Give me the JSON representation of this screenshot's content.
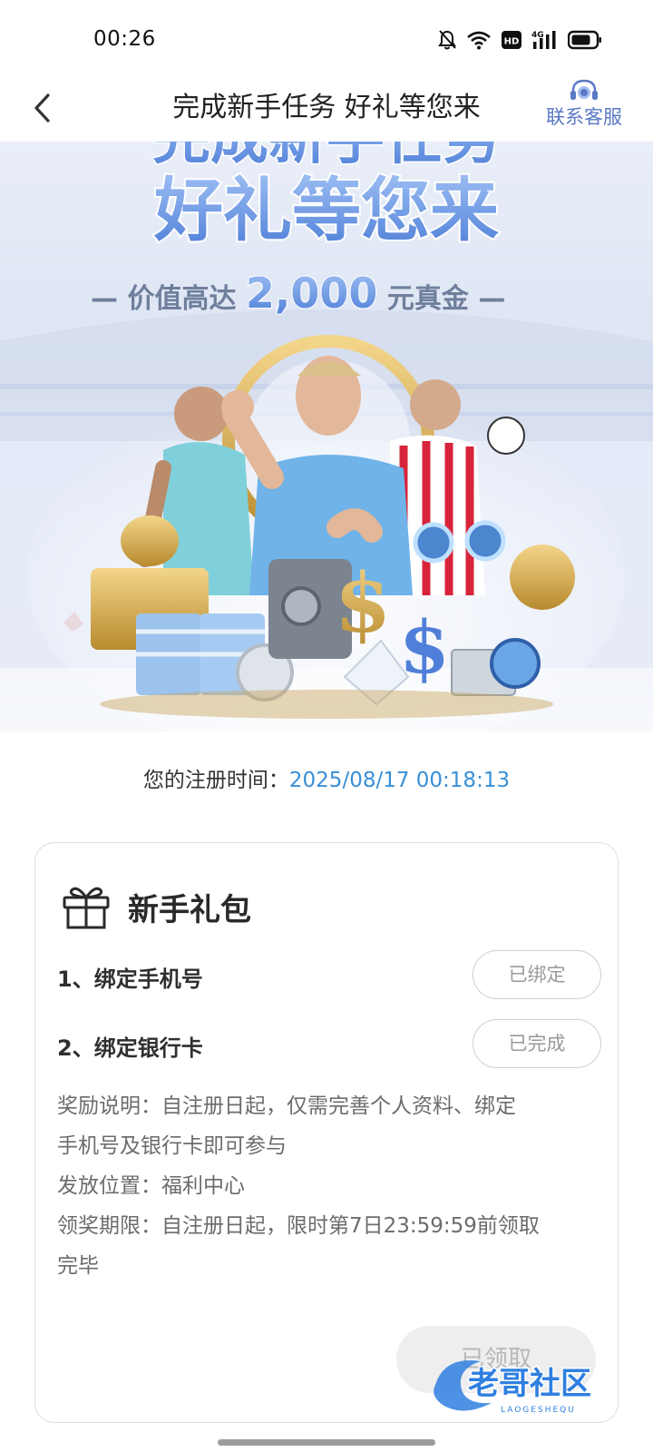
{
  "status_bar": {
    "time": "00:26",
    "icons": [
      "mute-icon",
      "wifi-icon",
      "hd-icon",
      "signal-4g-icon",
      "battery-icon"
    ],
    "hd_text": "HD",
    "net_text": "4G"
  },
  "nav": {
    "title": "完成新手任务 好礼等您来",
    "back_icon": "chevron-left-icon",
    "support_label": "联系客服",
    "support_icon": "headset-icon"
  },
  "banner": {
    "headline_top": "完成新手任务",
    "headline": "好礼等您来",
    "sub_prefix": "— 价值高达",
    "sub_amount": "2,000",
    "sub_suffix": "元真金 —"
  },
  "registration": {
    "label": "您的注册时间：",
    "value": "2025/08/17 00:18:13"
  },
  "gift_card": {
    "icon": "gift-icon",
    "title": "新手礼包",
    "tasks": [
      {
        "label": "1、绑定手机号",
        "status": "已绑定"
      },
      {
        "label": "2、绑定银行卡",
        "status": "已完成"
      }
    ],
    "reward_desc_1": "奖励说明：自注册日起，仅需完善个人资料、绑定",
    "reward_desc_2": "手机号及银行卡即可参与",
    "location": "发放位置：福利中心",
    "deadline_1": "领奖期限：自注册日起，限时第7日23:59:59前领取",
    "deadline_2": "完毕",
    "claim_label": "已领取"
  },
  "watermark": {
    "text": "老哥社区",
    "sub": "LAOGESHEQU"
  },
  "colors": {
    "accent_blue": "#3a8fd6",
    "support_blue": "#5a78c4",
    "headline_blue": "#6f9ce6"
  }
}
